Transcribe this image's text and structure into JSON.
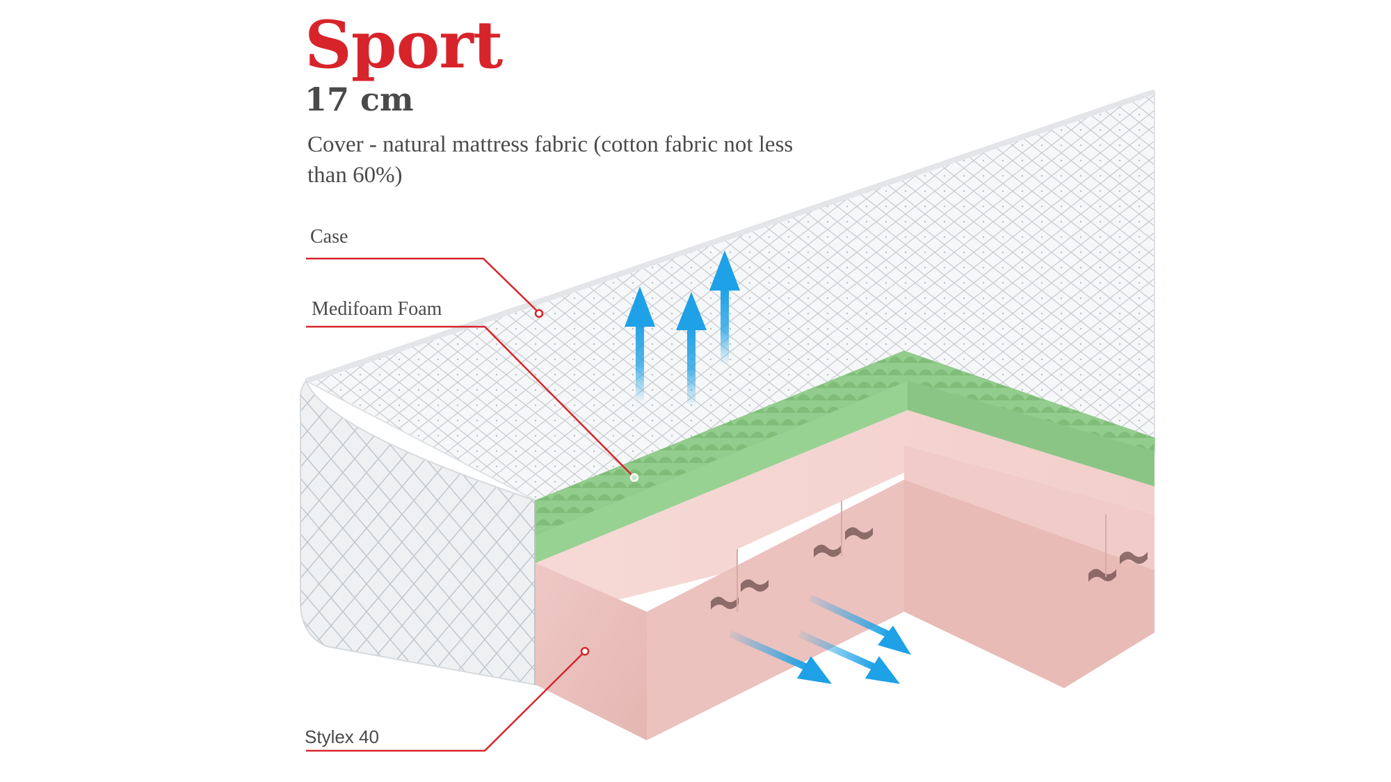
{
  "product": {
    "title": "Sport",
    "height": "17 cm",
    "cover_text": "Cover - natural mattress fabric (cotton fabric not less than 60%)"
  },
  "layers": [
    {
      "label": "Case"
    },
    {
      "label": "Medifoam Foam"
    },
    {
      "label": "Stylex 40"
    }
  ],
  "colors": {
    "title": "#d7242b",
    "text": "#4a4a4a",
    "leader_line": "#d7242b",
    "quilt_cover": "#f4f5f6",
    "medifoam_layer": "#9fd59a",
    "stylex_layer": "#f0c6c3",
    "airflow_arrows": "#1ea1e6"
  },
  "icons": {
    "airflow": "arrow-up-icon",
    "airflow_side": "arrow-diagonal-icon"
  }
}
